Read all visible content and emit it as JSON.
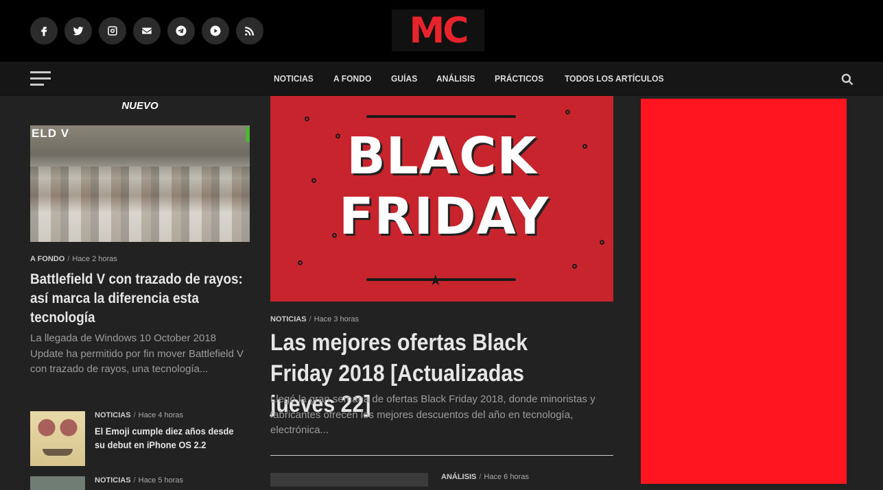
{
  "social": {
    "icons": [
      "facebook-icon",
      "twitter-icon",
      "instagram-icon",
      "email-icon",
      "telegram-icon",
      "youtube-icon",
      "rss-icon"
    ]
  },
  "logo": {
    "text": "MC",
    "color": "#e8232c"
  },
  "nav": {
    "items": [
      "NOTICIAS",
      "A FONDO",
      "GUÍAS",
      "ANÁLISIS",
      "PRÁCTICOS",
      "TODOS LOS ARTÍCULOS"
    ]
  },
  "left": {
    "section_title": "NUEVO",
    "image_text": "ELD V",
    "featured": {
      "category": "A FONDO",
      "time": "Hace 2 horas",
      "title": "Battlefield V con trazado de rayos: así marca la diferencia esta tecnología",
      "excerpt": "La llegada de Windows 10 October 2018 Update ha permitido por fin mover Battlefield V con trazado de rayos, una tecnología..."
    },
    "small": [
      {
        "category": "NOTICIAS",
        "time": "Hace 4 horas",
        "title": "El Emoji cumple diez años desde su debut en iPhone OS 2.2"
      },
      {
        "category": "NOTICIAS",
        "time": "Hace 5 horas",
        "title": ""
      }
    ]
  },
  "main": {
    "hero_text": "BLACK FRIDAY",
    "category": "NOTICIAS",
    "time": "Hace 3 horas",
    "title": "Las mejores ofertas Black Friday 2018 [Actualizadas jueves 22]",
    "excerpt": "Llegó la gran semana de ofertas Black Friday 2018, donde minoristas y fabricantes ofrecen los mejores descuentos del año en tecnología, electrónica...",
    "next": {
      "category": "ANÁLISIS",
      "time": "Hace 6 horas"
    }
  },
  "sidebar": {
    "ad_color": "#ff1520"
  },
  "colors": {
    "topbar": "#000000",
    "navbar": "#161616",
    "body": "#222222",
    "brand": "#e8232c"
  }
}
